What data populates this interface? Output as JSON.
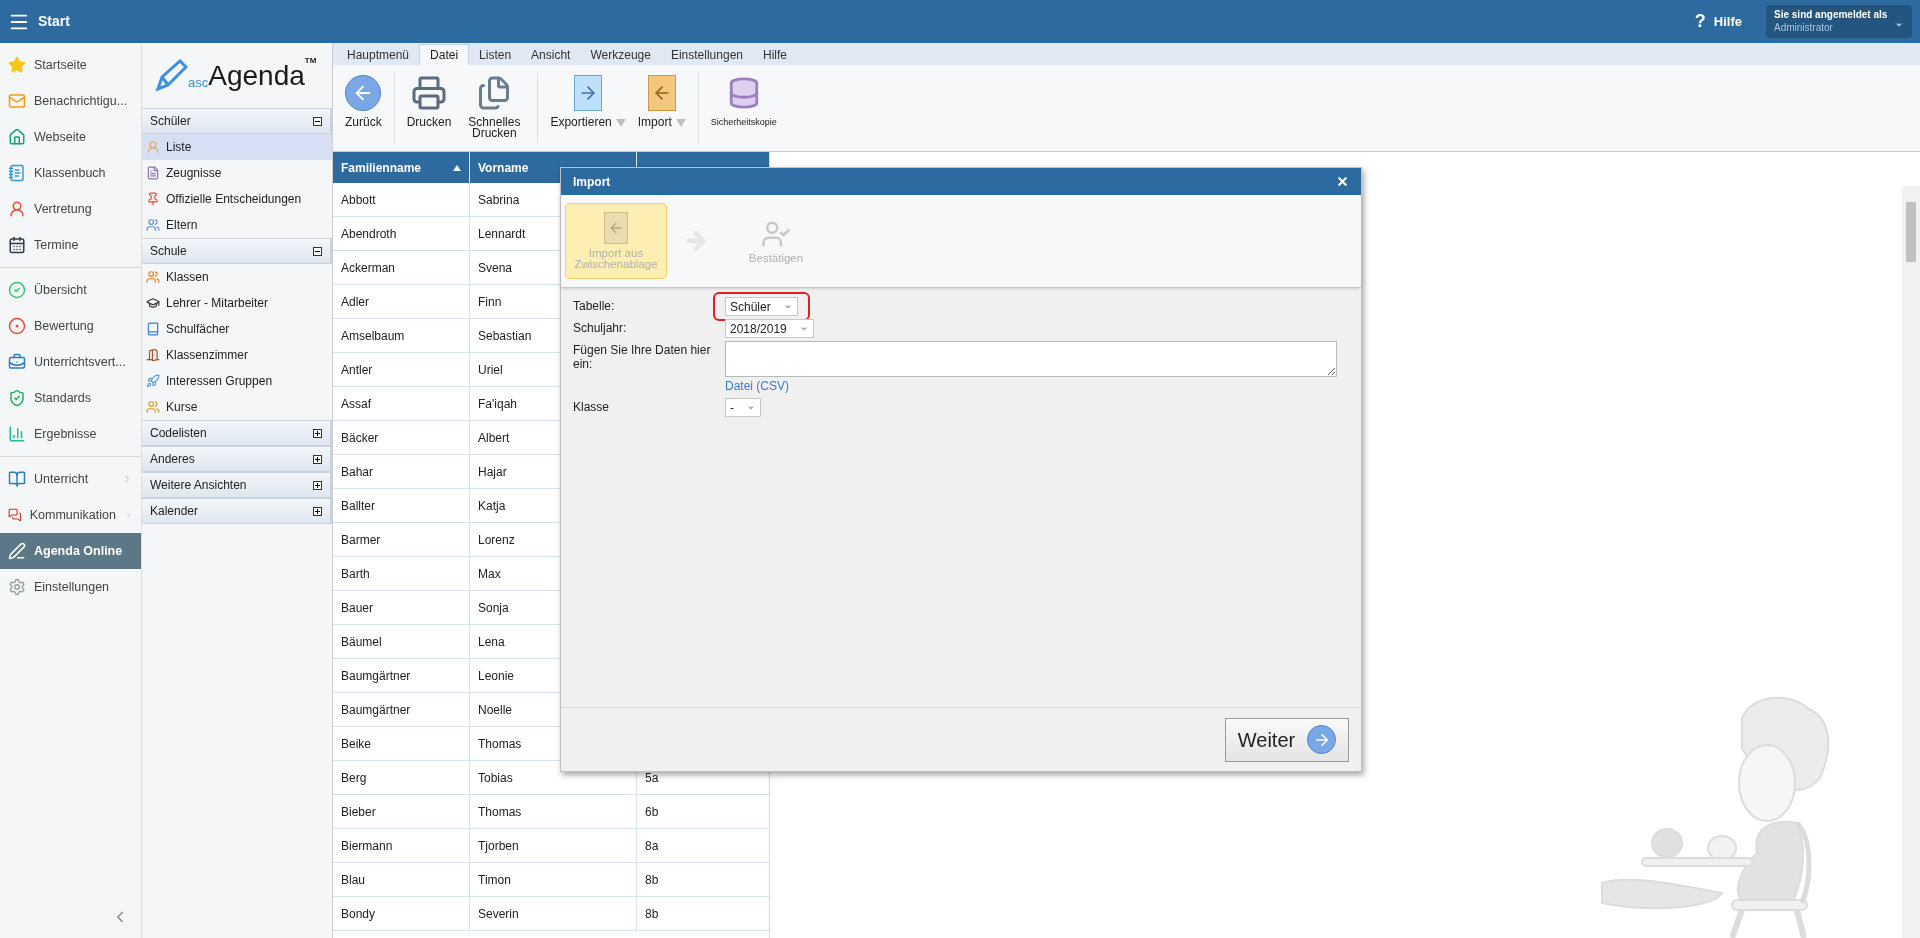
{
  "topbar": {
    "title": "Start",
    "help_icon": "?",
    "help": "Hilfe",
    "user_label": "Sie sind angemeldet als",
    "user": "Administrator"
  },
  "nav": {
    "groups": [
      [
        {
          "label": "Startseite",
          "selected": false,
          "has_submenu": false
        },
        {
          "label": "Benachrichtigu...",
          "selected": false,
          "has_submenu": false
        },
        {
          "label": "Webseite",
          "selected": false,
          "has_submenu": false
        },
        {
          "label": "Klassenbuch",
          "selected": false,
          "has_submenu": false
        },
        {
          "label": "Vertretung",
          "selected": false,
          "has_submenu": false
        },
        {
          "label": "Termine",
          "selected": false,
          "has_submenu": false
        }
      ],
      [
        {
          "label": "Übersicht",
          "selected": false,
          "has_submenu": false
        },
        {
          "label": "Bewertung",
          "selected": false,
          "has_submenu": false
        },
        {
          "label": "Unterrichtsvert...",
          "selected": false,
          "has_submenu": false
        },
        {
          "label": "Standards",
          "selected": false,
          "has_submenu": false
        },
        {
          "label": "Ergebnisse",
          "selected": false,
          "has_submenu": false
        }
      ],
      [
        {
          "label": "Unterricht",
          "selected": false,
          "has_submenu": true
        },
        {
          "label": "Kommunikation",
          "selected": false,
          "has_submenu": true
        },
        {
          "label": "Agenda Online",
          "selected": true,
          "has_submenu": false
        },
        {
          "label": "Einstellungen",
          "selected": false,
          "has_submenu": false
        }
      ]
    ]
  },
  "logo": {
    "prefix": "asc",
    "name": "Agenda",
    "mark": "TM"
  },
  "sections": [
    {
      "title": "Schüler",
      "expanded": true,
      "items": [
        {
          "label": "Liste",
          "selected": true
        },
        {
          "label": "Zeugnisse",
          "selected": false
        },
        {
          "label": "Offizielle Entscheidungen",
          "selected": false
        },
        {
          "label": "Eltern",
          "selected": false
        }
      ]
    },
    {
      "title": "Schule",
      "expanded": true,
      "items": [
        {
          "label": "Klassen",
          "selected": false
        },
        {
          "label": "Lehrer - Mitarbeiter",
          "selected": false
        },
        {
          "label": "Schulfächer",
          "selected": false
        },
        {
          "label": "Klassenzimmer",
          "selected": false
        },
        {
          "label": "Interessen Gruppen",
          "selected": false
        },
        {
          "label": "Kurse",
          "selected": false
        }
      ]
    },
    {
      "title": "Codelisten",
      "expanded": false
    },
    {
      "title": "Anderes",
      "expanded": false
    },
    {
      "title": "Weitere Ansichten",
      "expanded": false
    },
    {
      "title": "Kalender",
      "expanded": false
    }
  ],
  "ribbon": {
    "tabs": [
      {
        "label": "Hauptmenü",
        "selected": false
      },
      {
        "label": "Datei",
        "selected": true
      },
      {
        "label": "Listen",
        "selected": false
      },
      {
        "label": "Ansicht",
        "selected": false
      },
      {
        "label": "Werkzeuge",
        "selected": false
      },
      {
        "label": "Einstellungen",
        "selected": false
      },
      {
        "label": "Hilfe",
        "selected": false
      }
    ],
    "groups": [
      [
        {
          "label": "Zurück",
          "kind": "back",
          "dropdown": false
        }
      ],
      [
        {
          "label": "Drucken",
          "kind": "print",
          "dropdown": false
        },
        {
          "label": "Schnelles Drucken",
          "kind": "quickprint",
          "dropdown": false
        }
      ],
      [
        {
          "label": "Exportieren",
          "kind": "export",
          "dropdown": true
        },
        {
          "label": "Import",
          "kind": "import",
          "dropdown": true
        }
      ],
      [
        {
          "label": "Sicherheitskopie",
          "kind": "backup",
          "dropdown": false
        }
      ]
    ]
  },
  "table": {
    "columns": [
      {
        "label": "Familienname",
        "sorted": true
      },
      {
        "label": "Vorname",
        "sorted": false
      }
    ],
    "rows": [
      {
        "last": "Abbott",
        "first": "Sabrina"
      },
      {
        "last": "Abendroth",
        "first": "Lennardt"
      },
      {
        "last": "Ackerman",
        "first": "Svena"
      },
      {
        "last": "Adler",
        "first": "Finn"
      },
      {
        "last": "Amselbaum",
        "first": "Sebastian"
      },
      {
        "last": "Antler",
        "first": "Uriel"
      },
      {
        "last": "Assaf",
        "first": "Fa'iqah"
      },
      {
        "last": "Bäcker",
        "first": "Albert"
      },
      {
        "last": "Bahar",
        "first": "Hajar"
      },
      {
        "last": "Ballter",
        "first": "Katja"
      },
      {
        "last": "Barmer",
        "first": "Lorenz"
      },
      {
        "last": "Barth",
        "first": "Max"
      },
      {
        "last": "Bauer",
        "first": "Sonja"
      },
      {
        "last": "Bäumel",
        "first": "Lena"
      },
      {
        "last": "Baumgärtner",
        "first": "Leonie"
      },
      {
        "last": "Baumgärtner",
        "first": "Noelle"
      },
      {
        "last": "Beike",
        "first": "Thomas"
      },
      {
        "last": "Berg",
        "first": "Tobias",
        "class": "5a"
      },
      {
        "last": "Bieber",
        "first": "Thomas",
        "class": "6b"
      },
      {
        "last": "Biermann",
        "first": "Tjorben",
        "class": "8a"
      },
      {
        "last": "Blau",
        "first": "Timon",
        "class": "8b"
      },
      {
        "last": "Bondy",
        "first": "Severin",
        "class": "8b"
      }
    ]
  },
  "dialog": {
    "title": "Import",
    "steps": [
      {
        "label": "Import aus Zwischenablage",
        "selected": true,
        "kind": "clipboard"
      },
      {
        "label": "Bestätigen",
        "selected": false,
        "kind": "confirm"
      }
    ],
    "fields": [
      {
        "label": "Tabelle:",
        "kind": "select",
        "value": "Schüler",
        "highlighted": true
      },
      {
        "label": "Schuljahr:",
        "kind": "select",
        "value": "2018/2019",
        "highlighted": false
      },
      {
        "label": "Fügen Sie Ihre Daten hier ein:",
        "kind": "textarea",
        "link": "Datei (CSV)"
      },
      {
        "label": "Klasse",
        "kind": "select",
        "value": "-",
        "highlighted": false
      }
    ],
    "next_button": "Weiter"
  }
}
